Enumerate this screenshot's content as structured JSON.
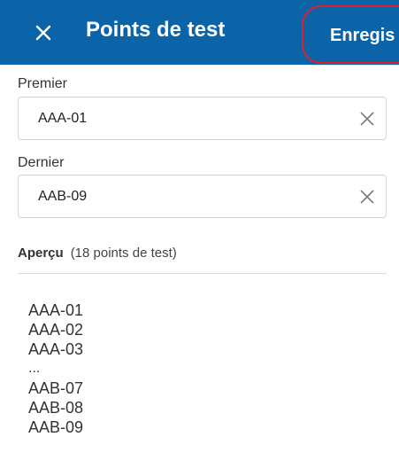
{
  "header": {
    "title": "Points de test",
    "save_label": "Enregis",
    "close_icon": "close-icon"
  },
  "first_field": {
    "label": "Premier",
    "value": "AAA-01",
    "clear_icon": "clear-icon"
  },
  "last_field": {
    "label": "Dernier",
    "value": "AAB-09",
    "clear_icon": "clear-icon"
  },
  "preview": {
    "title": "Aperçu",
    "count": "(18 points de test)",
    "items": [
      "AAA-01",
      "AAA-02",
      "AAA-03",
      "...",
      "AAB-07",
      "AAB-08",
      "AAB-09"
    ]
  },
  "colors": {
    "header_bg": "#0b64a8",
    "highlight": "#e0202a"
  }
}
